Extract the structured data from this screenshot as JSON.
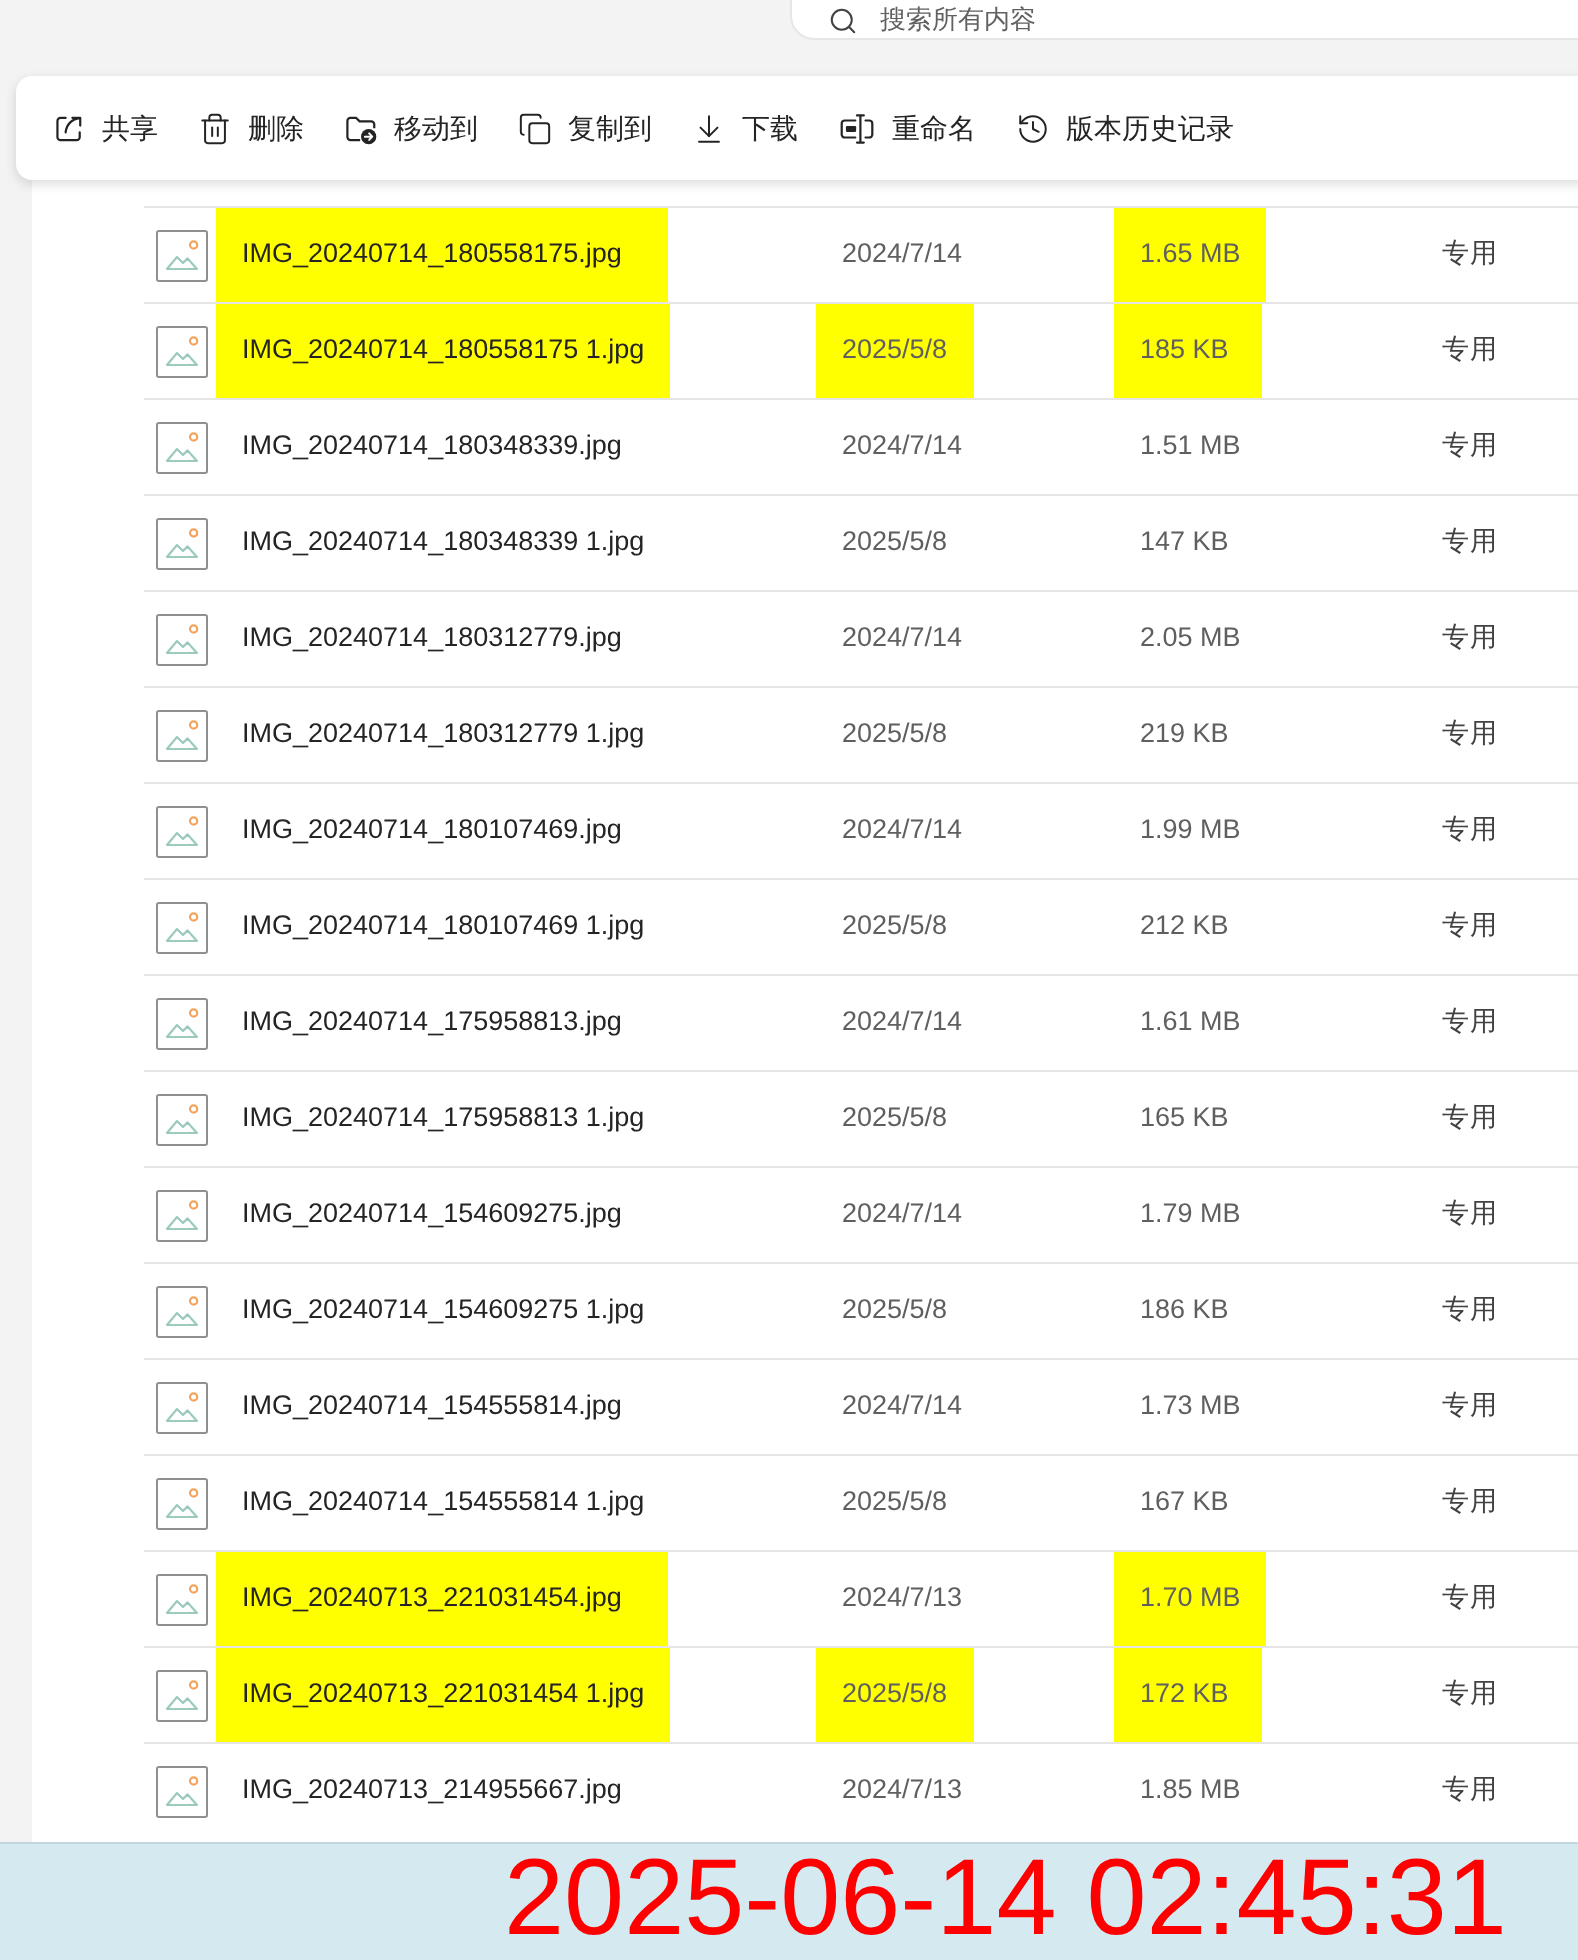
{
  "search": {
    "placeholder": "搜索所有内容"
  },
  "toolbar": {
    "buttons": [
      {
        "kind": "share",
        "label": "共享"
      },
      {
        "kind": "delete",
        "label": "删除"
      },
      {
        "kind": "move",
        "label": "移动到"
      },
      {
        "kind": "copy",
        "label": "复制到"
      },
      {
        "kind": "download",
        "label": "下载"
      },
      {
        "kind": "rename",
        "label": "重命名"
      },
      {
        "kind": "history",
        "label": "版本历史记录"
      }
    ]
  },
  "files": {
    "rows": [
      {
        "name": "IMG_20240714_180558175.jpg",
        "modified": "2024/7/14",
        "size": "1.65 MB",
        "sharing": "专用",
        "name_highlighted": true,
        "date_highlighted": false,
        "size_highlighted": true
      },
      {
        "name": "IMG_20240714_180558175 1.jpg",
        "modified": "2025/5/8",
        "size": "185 KB",
        "sharing": "专用",
        "name_highlighted": true,
        "date_highlighted": true,
        "size_highlighted": true
      },
      {
        "name": "IMG_20240714_180348339.jpg",
        "modified": "2024/7/14",
        "size": "1.51 MB",
        "sharing": "专用",
        "name_highlighted": false,
        "date_highlighted": false,
        "size_highlighted": false
      },
      {
        "name": "IMG_20240714_180348339 1.jpg",
        "modified": "2025/5/8",
        "size": "147 KB",
        "sharing": "专用",
        "name_highlighted": false,
        "date_highlighted": false,
        "size_highlighted": false
      },
      {
        "name": "IMG_20240714_180312779.jpg",
        "modified": "2024/7/14",
        "size": "2.05 MB",
        "sharing": "专用",
        "name_highlighted": false,
        "date_highlighted": false,
        "size_highlighted": false
      },
      {
        "name": "IMG_20240714_180312779 1.jpg",
        "modified": "2025/5/8",
        "size": "219 KB",
        "sharing": "专用",
        "name_highlighted": false,
        "date_highlighted": false,
        "size_highlighted": false
      },
      {
        "name": "IMG_20240714_180107469.jpg",
        "modified": "2024/7/14",
        "size": "1.99 MB",
        "sharing": "专用",
        "name_highlighted": false,
        "date_highlighted": false,
        "size_highlighted": false
      },
      {
        "name": "IMG_20240714_180107469 1.jpg",
        "modified": "2025/5/8",
        "size": "212 KB",
        "sharing": "专用",
        "name_highlighted": false,
        "date_highlighted": false,
        "size_highlighted": false
      },
      {
        "name": "IMG_20240714_175958813.jpg",
        "modified": "2024/7/14",
        "size": "1.61 MB",
        "sharing": "专用",
        "name_highlighted": false,
        "date_highlighted": false,
        "size_highlighted": false
      },
      {
        "name": "IMG_20240714_175958813 1.jpg",
        "modified": "2025/5/8",
        "size": "165 KB",
        "sharing": "专用",
        "name_highlighted": false,
        "date_highlighted": false,
        "size_highlighted": false
      },
      {
        "name": "IMG_20240714_154609275.jpg",
        "modified": "2024/7/14",
        "size": "1.79 MB",
        "sharing": "专用",
        "name_highlighted": false,
        "date_highlighted": false,
        "size_highlighted": false
      },
      {
        "name": "IMG_20240714_154609275 1.jpg",
        "modified": "2025/5/8",
        "size": "186 KB",
        "sharing": "专用",
        "name_highlighted": false,
        "date_highlighted": false,
        "size_highlighted": false
      },
      {
        "name": "IMG_20240714_154555814.jpg",
        "modified": "2024/7/14",
        "size": "1.73 MB",
        "sharing": "专用",
        "name_highlighted": false,
        "date_highlighted": false,
        "size_highlighted": false
      },
      {
        "name": "IMG_20240714_154555814 1.jpg",
        "modified": "2025/5/8",
        "size": "167 KB",
        "sharing": "专用",
        "name_highlighted": false,
        "date_highlighted": false,
        "size_highlighted": false
      },
      {
        "name": "IMG_20240713_221031454.jpg",
        "modified": "2024/7/13",
        "size": "1.70 MB",
        "sharing": "专用",
        "name_highlighted": true,
        "date_highlighted": false,
        "size_highlighted": true
      },
      {
        "name": "IMG_20240713_221031454 1.jpg",
        "modified": "2025/5/8",
        "size": "172 KB",
        "sharing": "专用",
        "name_highlighted": true,
        "date_highlighted": true,
        "size_highlighted": true
      },
      {
        "name": "IMG_20240713_214955667.jpg",
        "modified": "2024/7/13",
        "size": "1.85 MB",
        "sharing": "专用",
        "name_highlighted": false,
        "date_highlighted": false,
        "size_highlighted": false
      }
    ]
  },
  "timestamp_overlay": "2025-06-14 02:45:31"
}
